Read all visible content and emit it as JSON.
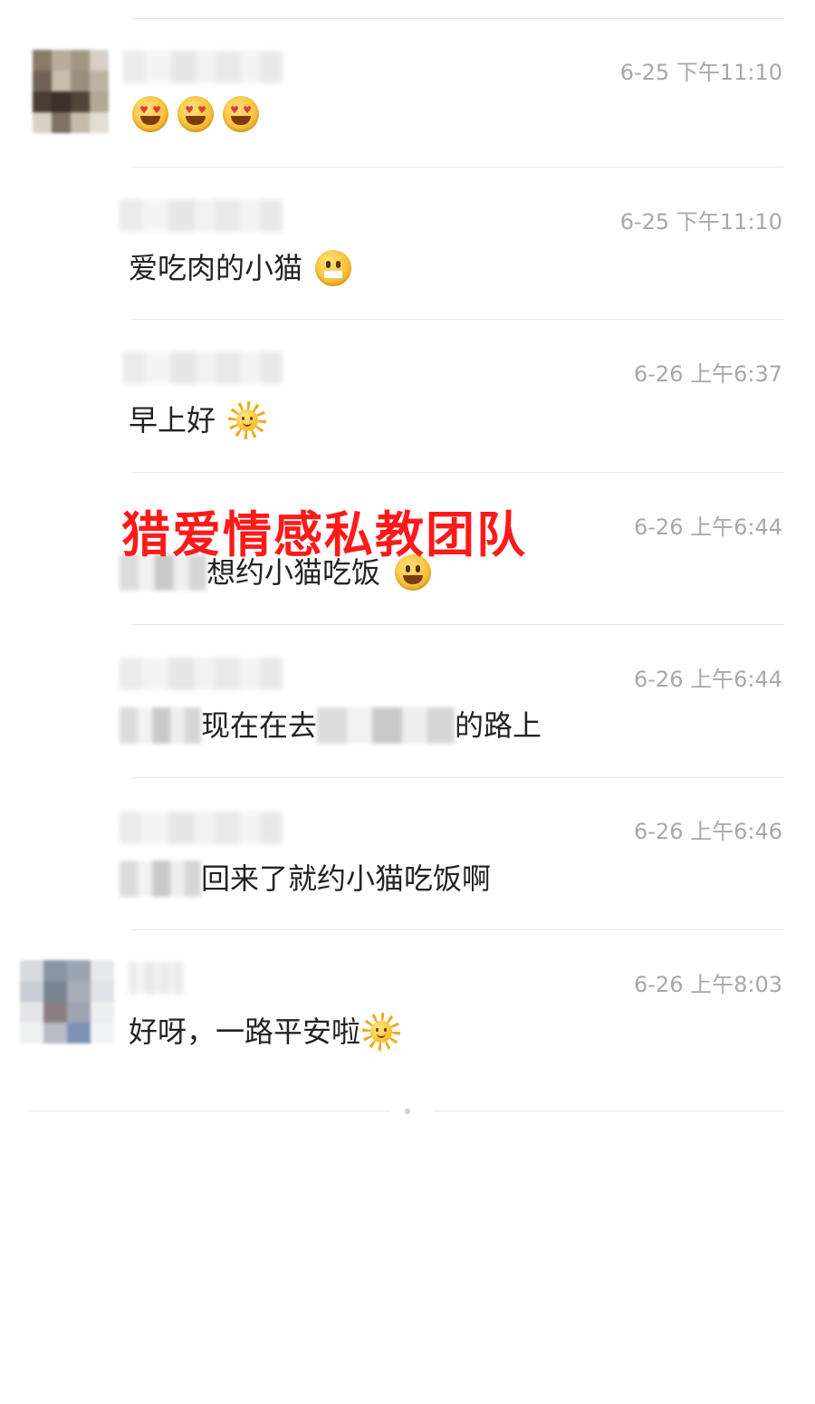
{
  "comments": [
    {
      "time": "6-25 下午11:10",
      "text": "",
      "emoji": [
        "heart-eyes-drool",
        "heart-eyes-drool",
        "heart-eyes-drool"
      ]
    },
    {
      "time": "6-25 下午11:10",
      "text": "爱吃肉的小猫",
      "emoji": [
        "grin"
      ]
    },
    {
      "time": "6-26 上午6:37",
      "text": "早上好",
      "emoji": [
        "sun"
      ]
    },
    {
      "time": "6-26 上午6:44",
      "text": "想约小猫吃饭",
      "emoji": [
        "smile"
      ]
    },
    {
      "time": "6-26 上午6:44",
      "text_a": "现在在去",
      "text_b": "的路上"
    },
    {
      "time": "6-26 上午6:46",
      "text": "回来了就约小猫吃饭啊"
    },
    {
      "time": "6-26 上午8:03",
      "text": "好呀，一路平安啦",
      "emoji": [
        "sun"
      ]
    }
  ],
  "watermark": "猎爱情感私教团队",
  "colors": {
    "timestamp": "#a8a8a8",
    "text": "#222222",
    "divider": "#e6e6e6",
    "watermark": "#ff1a1a"
  }
}
